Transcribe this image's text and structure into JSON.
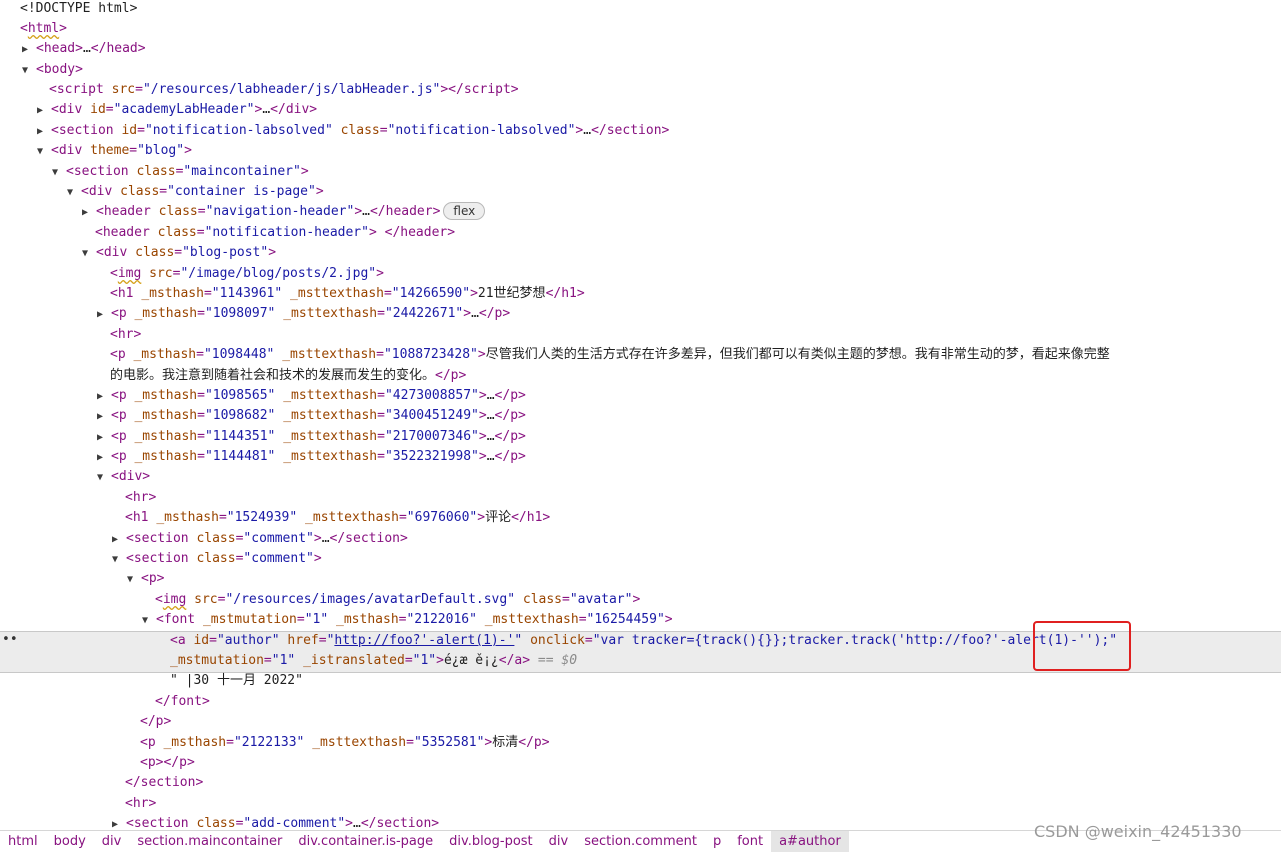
{
  "dom": {
    "doctype": "<!DOCTYPE html>",
    "l_html": "html",
    "l_head": "head",
    "l_body": "body",
    "script_src": "\"/resources/labheader/js/labHeader.js\"",
    "div_academy_id": "\"academyLabHeader\"",
    "section_notif_id": "\"notification-labsolved\"",
    "section_notif_class": "\"notification-labsolved\"",
    "div_theme": "\"blog\"",
    "section_main_class": "\"maincontainer\"",
    "div_container_class": "\"container is-page\"",
    "header_nav_class": "\"navigation-header\"",
    "flex_badge": "flex",
    "header_notif_class": "\"notification-header\"",
    "div_blogpost_class": "\"blog-post\"",
    "img_src": "\"/image/blog/posts/2.jpg\"",
    "h1_msthash": "\"1143961\"",
    "h1_msttexthash": "\"14266590\"",
    "h1_text": "21世纪梦想",
    "p1_msthash": "\"1098097\"",
    "p1_msttexthash": "\"24422671\"",
    "p2_msthash": "\"1098448\"",
    "p2_msttexthash": "\"1088723428\"",
    "p2_text_line1": "尽管我们人类的生活方式存在许多差异，但我们都可以有类似主题的梦想。我有非常生动的梦，看起来像完整",
    "p2_text_line2": "的电影。我注意到随着社会和技术的发展而发生的变化。",
    "p3_msthash": "\"1098565\"",
    "p3_msttexthash": "\"4273008857\"",
    "p4_msthash": "\"1098682\"",
    "p4_msttexthash": "\"3400451249\"",
    "p5_msthash": "\"1144351\"",
    "p5_msttexthash": "\"2170007346\"",
    "p6_msthash": "\"1144481\"",
    "p6_msttexthash": "\"3522321998\"",
    "h1b_msthash": "\"1524939\"",
    "h1b_msttexthash": "\"6976060\"",
    "h1b_text": "评论",
    "comment_class": "\"comment\"",
    "avatar_src": "\"/resources/images/avatarDefault.svg\"",
    "avatar_class": "\"avatar\"",
    "font_mstmutation": "\"1\"",
    "font_msthash": "\"2122016\"",
    "font_msttexthash": "\"16254459\"",
    "a_id": "\"author\"",
    "a_href": "http://foo?'-alert(1)-'",
    "a_onclick": "\"var tracker={track(){}};tracker.track('http://foo?'-alert(1)-'');\"",
    "a_mstmutation": "\"1\"",
    "a_istranslated": "\"1\"",
    "a_text": "é¿æ ě¡¿",
    "eq_ref": "== $0",
    "date_text": "\" |30 十一月 2022\"",
    "p7_msthash": "\"2122133\"",
    "p7_msttexthash": "\"5352581\"",
    "p7_text": "标清",
    "addcomment_class": "\"add-comment\"",
    "ellipsis": "…",
    "row_dots": "••"
  },
  "breadcrumbs": [
    "html",
    "body",
    "div",
    "section.maincontainer",
    "div.container.is-page",
    "div.blog-post",
    "div",
    "section.comment",
    "p",
    "font",
    "a#author"
  ],
  "watermark": "CSDN @weixin_42451330"
}
